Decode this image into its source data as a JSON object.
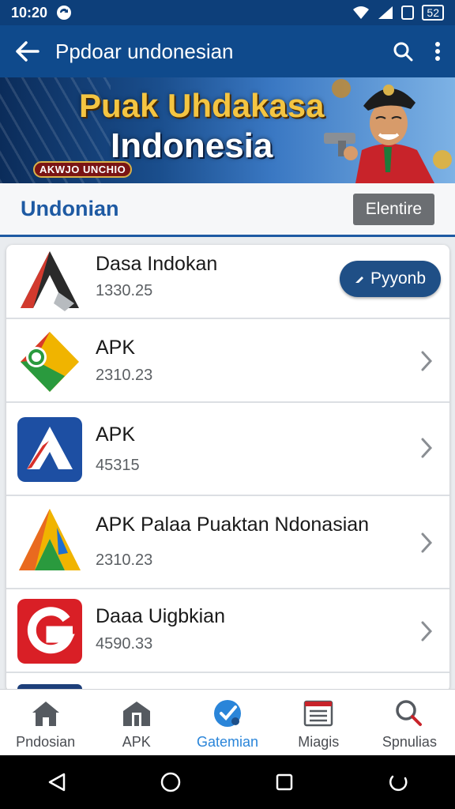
{
  "status": {
    "time": "10:20",
    "battery": "52"
  },
  "appbar": {
    "title": "Ppdoar undonesian"
  },
  "banner": {
    "line1": "Puak Uhdakasa",
    "line2": "Indonesia",
    "badge": "AKWJO UNCHIO"
  },
  "section": {
    "title": "Undonian",
    "button": "Elentire"
  },
  "list": [
    {
      "name": "Dasa Indokan",
      "sub": "1330.25",
      "action": "Pyyonb",
      "icon": "a-logo-dark-icon"
    },
    {
      "name": "APK",
      "sub": "2310.23",
      "icon": "a-logo-tricolor-icon"
    },
    {
      "name": "APK",
      "sub": "45315",
      "icon": "a-logo-blue-icon"
    },
    {
      "name": "APK  Palaa Puaktan Ndonasian",
      "sub": "2310.23",
      "icon": "a-logo-colorful-icon"
    },
    {
      "name": "Daaa Uigbkian",
      "sub": "4590.33",
      "icon": "g-logo-red-icon"
    }
  ],
  "bottomnav": [
    {
      "label": "Pndosian",
      "icon": "home-icon"
    },
    {
      "label": "APK",
      "icon": "store-icon"
    },
    {
      "label": "Gatemian",
      "icon": "gate-icon",
      "active": true
    },
    {
      "label": "Miagis",
      "icon": "news-icon"
    },
    {
      "label": "Spnulias",
      "icon": "search-icon"
    }
  ],
  "colors": {
    "appbar": "#0f4a8c",
    "accent": "#1e5aa3",
    "active_nav": "#2a85d9",
    "primary_button": "#1f4f86"
  }
}
